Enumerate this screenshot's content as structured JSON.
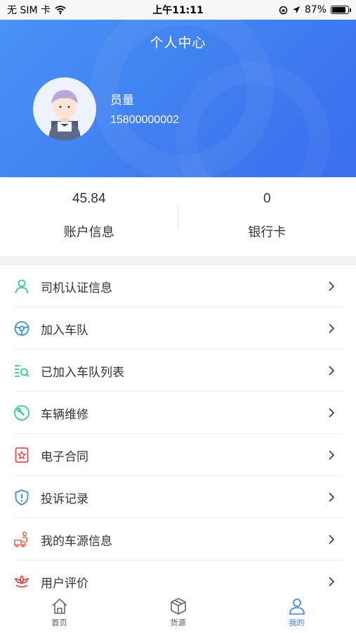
{
  "status_bar": {
    "carrier": "无 SIM 卡",
    "time": "上午11:11",
    "battery": "87%",
    "battery_level": 0.87
  },
  "header": {
    "title": "个人中心",
    "user_name": "员量",
    "phone": "15800000002"
  },
  "stats": [
    {
      "value": "45.84",
      "label": "账户信息"
    },
    {
      "value": "0",
      "label": "银行卡"
    }
  ],
  "menu": [
    {
      "label": "司机认证信息",
      "icon": "user-icon",
      "color": "#3cc79b"
    },
    {
      "label": "加入车队",
      "icon": "steering-wheel-icon",
      "color": "#3a8ee6"
    },
    {
      "label": "已加入车队列表",
      "icon": "list-search-icon",
      "color": "#3cc79b"
    },
    {
      "label": "车辆维修",
      "icon": "wrench-icon",
      "color": "#3cc79b"
    },
    {
      "label": "电子合同",
      "icon": "contract-icon",
      "color": "#e84a4a"
    },
    {
      "label": "投诉记录",
      "icon": "shield-alert-icon",
      "color": "#3a8ee6"
    },
    {
      "label": "我的车源信息",
      "icon": "truck-person-icon",
      "color": "#e86a4a"
    },
    {
      "label": "用户评价",
      "icon": "flower-rating-icon",
      "color": "#e84a4a"
    }
  ],
  "tabs": [
    {
      "label": "首页",
      "icon": "home-icon"
    },
    {
      "label": "货源",
      "icon": "box-icon"
    },
    {
      "label": "我的",
      "icon": "profile-icon",
      "active": true
    }
  ],
  "colors": {
    "accent": "#3a7af0",
    "green": "#3cc79b",
    "red": "#e84a4a"
  }
}
